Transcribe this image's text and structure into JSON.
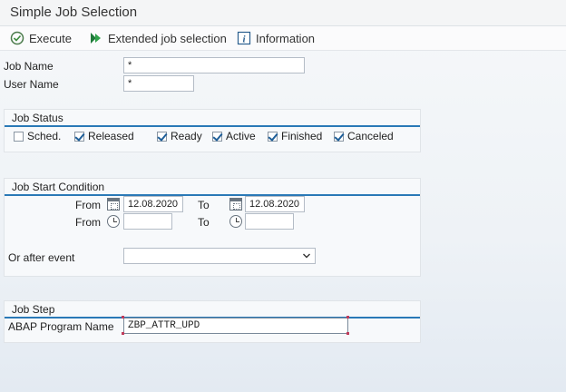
{
  "window": {
    "title": "Simple Job Selection"
  },
  "toolbar": {
    "execute": "Execute",
    "extended": "Extended job selection",
    "information": "Information"
  },
  "form": {
    "job_name_label": "Job Name",
    "job_name_value": "*",
    "user_name_label": "User Name",
    "user_name_value": "*"
  },
  "job_status": {
    "title": "Job Status",
    "options": [
      {
        "label": "Sched.",
        "checked": false
      },
      {
        "label": "Released",
        "checked": true
      },
      {
        "label": "Ready",
        "checked": true
      },
      {
        "label": "Active",
        "checked": true
      },
      {
        "label": "Finished",
        "checked": true
      },
      {
        "label": "Canceled",
        "checked": true
      }
    ]
  },
  "start_condition": {
    "title": "Job Start Condition",
    "from_label": "From",
    "to_label": "To",
    "from_date": "12.08.2020",
    "to_date": "12.08.2020",
    "from_time": "",
    "to_time": "",
    "after_event_label": "Or after event",
    "after_event_value": ""
  },
  "job_step": {
    "title": "Job Step",
    "program_label": "ABAP Program Name",
    "program_value": "ZBP_ATTR_UPD"
  },
  "colors": {
    "accent": "#2a79b7",
    "required": "#c03b5b"
  }
}
